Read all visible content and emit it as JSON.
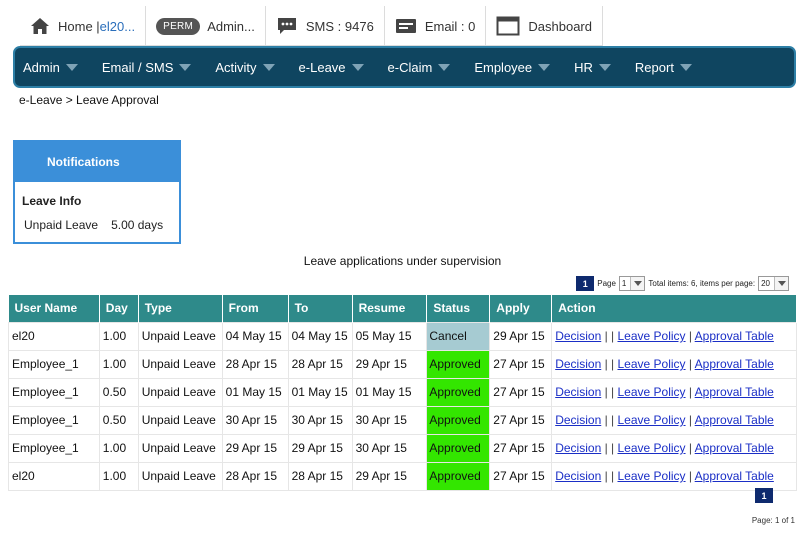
{
  "topbar": {
    "home_label": "Home | ",
    "home_user": "el20...",
    "perm_badge": "PERM",
    "admin_label": "Admin...",
    "sms_label": "SMS : 9476",
    "email_label": "Email : 0",
    "dashboard_label": "Dashboard"
  },
  "nav": {
    "items": [
      "Admin",
      "Email / SMS",
      "Activity",
      "e-Leave",
      "e-Claim",
      "Employee",
      "HR",
      "Report"
    ]
  },
  "breadcrumb": "e-Leave > Leave Approval",
  "notifications": {
    "header": "Notifications",
    "title": "Leave Info",
    "leave_type": "Unpaid Leave",
    "leave_days": "5.00 days"
  },
  "table": {
    "caption": "Leave applications under supervision",
    "pager": {
      "current_page": "1",
      "page_label": "Page",
      "page_select": "1",
      "total_text": "Total items: 6, items per page:",
      "per_page": "20",
      "footer": "Page: 1 of 1"
    },
    "columns": [
      "User Name",
      "Day",
      "Type",
      "From",
      "To",
      "Resume",
      "Status",
      "Apply",
      "Action"
    ],
    "rows": [
      {
        "user": "el20",
        "day": "1.00",
        "type": "Unpaid Leave",
        "from": "04 May 15",
        "to": "04 May 15",
        "resume": "05 May 15",
        "status": "Cancel",
        "apply": "29 Apr 15"
      },
      {
        "user": "Employee_1",
        "day": "1.00",
        "type": "Unpaid Leave",
        "from": "28 Apr 15",
        "to": "28 Apr 15",
        "resume": "29 Apr 15",
        "status": "Approved",
        "apply": "27 Apr 15"
      },
      {
        "user": "Employee_1",
        "day": "0.50",
        "type": "Unpaid Leave",
        "from": "01 May 15",
        "to": "01 May 15",
        "resume": "01 May 15",
        "status": "Approved",
        "apply": "27 Apr 15"
      },
      {
        "user": "Employee_1",
        "day": "0.50",
        "type": "Unpaid Leave",
        "from": "30 Apr 15",
        "to": "30 Apr 15",
        "resume": "30 Apr 15",
        "status": "Approved",
        "apply": "27 Apr 15"
      },
      {
        "user": "Employee_1",
        "day": "1.00",
        "type": "Unpaid Leave",
        "from": "29 Apr 15",
        "to": "29 Apr 15",
        "resume": "30 Apr 15",
        "status": "Approved",
        "apply": "27 Apr 15"
      },
      {
        "user": "el20",
        "day": "1.00",
        "type": "Unpaid Leave",
        "from": "28 Apr 15",
        "to": "28 Apr 15",
        "resume": "29 Apr 15",
        "status": "Approved",
        "apply": "27 Apr 15"
      }
    ],
    "actions": {
      "decision": "Decision",
      "sep1": " | | ",
      "leave_policy": "Leave Policy",
      "sep2": " | ",
      "approval_table": "Approval Table"
    }
  },
  "colors": {
    "nav_bg": "#0f4560",
    "header_bg": "#2e8a8a",
    "approved": "#33e600",
    "cancel": "#a6cbd2",
    "notif": "#3b8fd9"
  }
}
